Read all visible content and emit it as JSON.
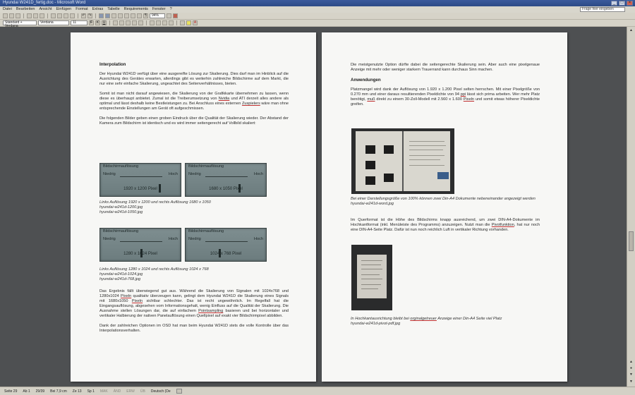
{
  "app": {
    "window_title": "Hyundai W241D_fertig.doc - Microsoft Word",
    "help_placeholder": "Frage hier eingeben"
  },
  "menu": [
    "Datei",
    "Bearbeiten",
    "Ansicht",
    "Einfügen",
    "Format",
    "Extras",
    "Tabelle",
    "Requirements",
    "Fenster",
    "?"
  ],
  "toolbar": {
    "style_value": "Standard + Verdana",
    "font_value": "Verdana",
    "size_value": "11",
    "zoom_value": "94%"
  },
  "statusbar": {
    "page": "Seite 29",
    "section": "Ab 1",
    "page_of": "29/39",
    "position": "Bei 7,9 cm",
    "line": "Ze 13",
    "column": "Sp 1",
    "mak": "MAK",
    "aen": "ÄND",
    "erw": "ERW",
    "ub": "ÜB",
    "language": "Deutsch (De"
  },
  "left_page": {
    "heading": "Interpolation",
    "p1": "Der Hyundai W241D verfügt über eine ausgereifte Lösung zur Skalierung. Dies darf man im Hinblick auf die Ausrichtung des Gerätes erwarten, allerdings gibt es weiterhin zahlreiche Bildschirme auf dem Markt, die nur eine sehr einfache Skalierung, ungeachtet des Seitenverhältnisses, bieten.",
    "p2_a": "Somit ist man nicht darauf angewiesen, die Skalierung von der Grafikkarte übernehmen zu lassen, wenn diese es überhaupt anbietet. Zumal ist die Treiberumsetzung von ",
    "p2_nvidia": "Nvidia",
    "p2_b": " und ATI derzeit alles andere als optimal und lässt deshalb keine Bestleistungen zu. Bei Anschluss eines externen ",
    "p2_zuspielers": "Zuspielers",
    "p2_c": " wäre man ohne entsprechende Einstellungen am Gerät oft aufgeschmissen.",
    "p3": "Die folgenden Bilder geben einen groben Eindruck über die Qualität der Skalierung wieder. Der Abstand der Kamera zum Bildschirm ist identisch und es wird immer seitengerecht auf Vollbild skaliert:",
    "osd_title": "Bildschirmauflösung",
    "osd_low": "Niedrig",
    "osd_high": "Hoch",
    "osd_res1": "1920 x 1200 Pixel",
    "osd_res2": "1680 x 1050 Pixel",
    "osd_res3": "1280 x 1024 Pixel",
    "osd_res4": "1024 x 768 Pixel",
    "osd_level1": 0.92,
    "osd_level2": 0.78,
    "osd_level3": 0.48,
    "osd_level4": 0.32,
    "cap1_line1": "Links Auflösung 1920 x 1200 und rechts Auflösung 1680 x 1050",
    "cap1_line2": "hyundai-w241d-1200.jpg",
    "cap1_line3": "hyundai-w241d-1050.jpg",
    "cap2_line1": "Links Auflösung 1280 x 1024 und rechts Auflösung 1024 x 768",
    "cap2_line2": "hyundai-w241d-1024.jpg",
    "cap2_line3": "hyundai-w241d-768.jpg",
    "p4_a": "Das Ergebnis fällt überwiegend gut aus. Während die Skalierung von Signalen mit 1024x768 und 1280x1024 ",
    "p4_pixeln1": "Pixeln",
    "p4_b": " qualitativ überzeugen kann, gelingt dem Hyundai W241D die Skalierung eines Signals mit 1680x1050 ",
    "p4_pixeln2": "Pixeln",
    "p4_c": " sichtbar schlechter. Das ist recht ungewöhnlich. Im Regelfall hat die Eingangsauflösung, abgesehen vom Informationsgehalt, wenig Einfluss auf die Qualität der Skalierung. Die Ausnahme stellen Lösungen dar, die auf einfachem ",
    "p4_point": "Pointsampling",
    "p4_d": " basieren und bei horizontaler und vertikaler Halbierung der nativen Panelauflösung einen Quellpixel auf exakt vier Bildschirmpixel abbilden.",
    "p5": "Dank der zahlreichen Optionen im OSD hat man beim Hyundai W241D stets die volle Kontrolle über das Interpolationsverhalten."
  },
  "right_page": {
    "p1": "Die meistgenutzte Option dürfte dabei die seitengerechte Skalierung sein. Aber auch eine pixelgenaue Anzeige mit mehr oder weniger starkem Trauerrand kann durchaus Sinn machen.",
    "heading": "Anwendungen",
    "p2_a": "Platzmangel wird dank der Auflösung von 1.920 x 1.200 Pixel selten herrschen. Mit einer Pixelgröße von 0.270 mm und einer daraus resultierenden Pixeldichte von 94 ",
    "p2_ppi": "ppi",
    "p2_b": " lässt sich prima arbeiten. Wer mehr Platz benötigt, ",
    "p2_muss": "muß",
    "p2_c": " direkt zu einem 30-Zoll-Modell mit 2.560 x 1.600 ",
    "p2_pixeln": "Pixeln",
    "p2_d": " und somit etwas höherer Pixeldichte greifen.",
    "cap1_line1": "Bei einer Darstellungsgröße von 100% können zwei Din-A4 Dokumente nebeneinander angezeigt werden",
    "cap1_line2": "hyundai-w241d-word.jpg",
    "p3_a": "Im Querformat ist die Höhe des Bildschirms knapp ausreichend, um zwei DIN-A4-Dokumente im Hochkantformat (inkl. Menüleiste des Programms) anzuzeigen. Nutzt man die ",
    "p3_pivot": "Pivotfunktion",
    "p3_b": ", hat nur noch eine DIN-A4-Seite Platz. Dafür ist nun noch reichlich Luft in vertikaler Richtung vorhanden.",
    "cap2_a": "In Hochkantausrichtung bleibt bei ",
    "cap2_orig": "orginalgetreuer",
    "cap2_b": " Anzeige einer Din-A4 Seite viel Platz",
    "cap2_line2": "hyundai-w241d-pivot-pdf.jpg"
  }
}
